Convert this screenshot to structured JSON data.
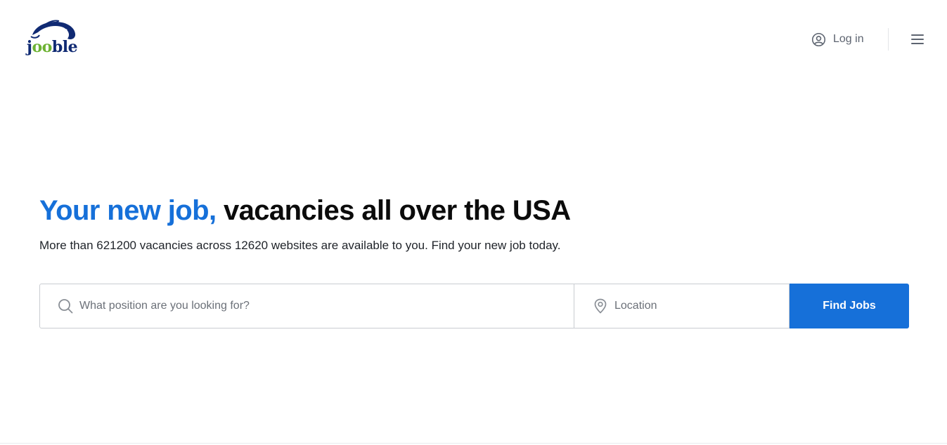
{
  "header": {
    "logo": {
      "text_part1": "j",
      "text_oo": "oo",
      "text_part2": "ble"
    },
    "login_label": "Log in",
    "icons": {
      "login": "user-circle-icon",
      "menu": "hamburger-menu-icon"
    }
  },
  "hero": {
    "headline_accent": "Your new job,",
    "headline_rest": " vacancies all over the USA",
    "subtitle": "More than 621200 vacancies across 12620 websites are available to you. Find your new job today."
  },
  "search": {
    "position_placeholder": "What position are you looking for?",
    "position_value": "",
    "location_placeholder": "Location",
    "location_value": "",
    "button_label": "Find Jobs",
    "icons": {
      "position": "search-icon",
      "location": "map-pin-icon"
    }
  },
  "colors": {
    "accent": "#1670d9",
    "logo_navy": "#102a73",
    "logo_green": "#6db233"
  }
}
